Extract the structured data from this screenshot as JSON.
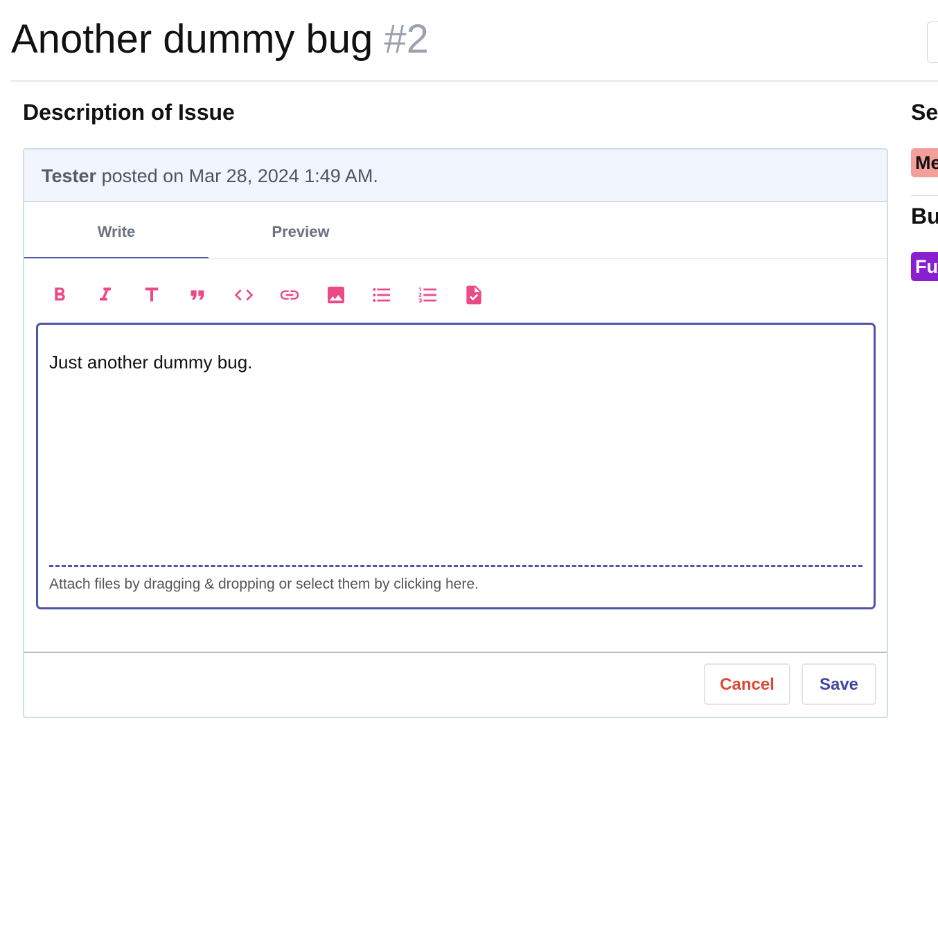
{
  "issue": {
    "title": "Another dummy bug",
    "number": "#2"
  },
  "section_title": "Description of Issue",
  "post": {
    "author": "Tester",
    "meta": "posted on Mar 28, 2024 1:49 AM."
  },
  "tabs": [
    {
      "label": "Write",
      "active": true
    },
    {
      "label": "Preview",
      "active": false
    }
  ],
  "toolbar": {
    "icons": [
      "bold-icon",
      "italic-icon",
      "heading-icon",
      "quote-icon",
      "code-icon",
      "link-icon",
      "image-icon",
      "bulleted-list-icon",
      "numbered-list-icon",
      "checklist-icon"
    ],
    "icon_color": "#ec4a85"
  },
  "editor": {
    "content": "Just another dummy bug.",
    "attach_hint": "Attach files by dragging & dropping or select them by clicking here."
  },
  "buttons": {
    "cancel": "Cancel",
    "save": "Save"
  },
  "sidebar": {
    "severity_heading": "Se",
    "severity_badge": "Me",
    "severity_color": "#f3a09a",
    "bug_type_heading": "Bu",
    "bug_type_badge": "Fu",
    "bug_type_color": "#8a1fd0"
  }
}
